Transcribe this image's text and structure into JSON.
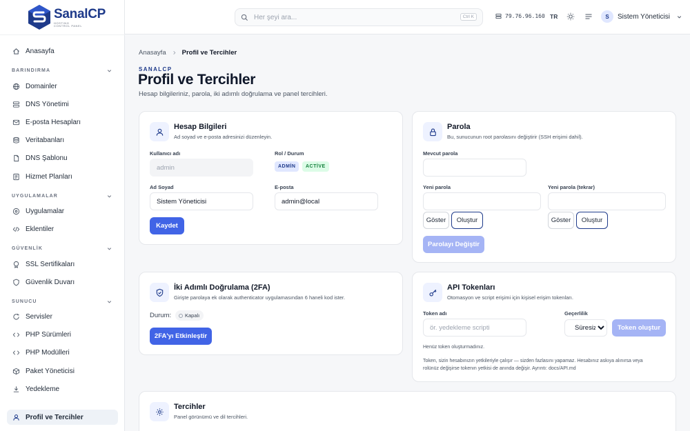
{
  "brand": {
    "name": "SanalCP",
    "tagline_1": "HOSTING",
    "tagline_2": "CONTROL PANEL"
  },
  "colors": {
    "primary": "#4164e6",
    "navy": "#1e3a8a",
    "success": "#15803d"
  },
  "sidebar": {
    "home": {
      "label": "Anasayfa",
      "icon": "home-icon"
    },
    "sections": [
      {
        "title": "BARINDIRMA",
        "items": [
          {
            "label": "Domainler",
            "icon": "globe-icon"
          },
          {
            "label": "DNS Yönetimi",
            "icon": "dns-icon"
          },
          {
            "label": "E-posta Hesapları",
            "icon": "mail-icon"
          },
          {
            "label": "Veritabanları",
            "icon": "database-icon"
          },
          {
            "label": "DNS Şablonu",
            "icon": "template-icon"
          },
          {
            "label": "Hizmet Planları",
            "icon": "plans-icon"
          }
        ]
      },
      {
        "title": "UYGULAMALAR",
        "items": [
          {
            "label": "Uygulamalar",
            "icon": "apps-icon"
          },
          {
            "label": "Eklentiler",
            "icon": "code-icon"
          }
        ]
      },
      {
        "title": "GÜVENLİK",
        "items": [
          {
            "label": "SSL Sertifikaları",
            "icon": "certificate-icon"
          },
          {
            "label": "Güvenlik Duvarı",
            "icon": "shield-icon"
          }
        ]
      },
      {
        "title": "SUNUCU",
        "items": [
          {
            "label": "Servisler",
            "icon": "refresh-icon"
          },
          {
            "label": "PHP Sürümleri",
            "icon": "php-icon"
          },
          {
            "label": "PHP Modülleri",
            "icon": "module-icon"
          },
          {
            "label": "Paket Yöneticisi",
            "icon": "package-icon"
          },
          {
            "label": "Yedekleme",
            "icon": "download-icon"
          }
        ]
      }
    ],
    "profile": {
      "label": "Profil ve Tercihler",
      "icon": "user-icon",
      "active": true
    }
  },
  "topbar": {
    "search_placeholder": "Her şeyi ara...",
    "shortcut": "Ctrl K",
    "ip": "79.76.96.160",
    "lang": "TR",
    "user_initial": "S",
    "user_name": "Sistem Yöneticisi"
  },
  "breadcrumb": {
    "home": "Anasayfa",
    "current": "Profil ve Tercihler"
  },
  "header": {
    "eyebrow": "SANALCP",
    "title": "Profil ve Tercihler",
    "subtitle": "Hesap bilgileriniz, parola, iki adımlı doğrulama ve panel tercihleri."
  },
  "account": {
    "title": "Hesap Bilgileri",
    "desc": "Ad soyad ve e-posta adresinizi düzenleyin.",
    "username_label": "Kullanıcı adı",
    "username_value": "admin",
    "role_label": "Rol / Durum",
    "role_badge": "ADMİN",
    "status_badge": "ACTİVE",
    "fullname_label": "Ad Soyad",
    "fullname_value": "Sistem Yöneticisi",
    "email_label": "E-posta",
    "email_value": "admin@local",
    "save_label": "Kaydet"
  },
  "password": {
    "title": "Parola",
    "desc": "Bu, sunucunun root parolasını değiştirir (SSH erişimi dahil).",
    "current_label": "Mevcut parola",
    "new_label": "Yeni parola",
    "repeat_label": "Yeni parola (tekrar)",
    "show_label": "Göster",
    "generate_label": "Oluştur",
    "submit_label": "Parolayı Değiştir"
  },
  "twofa": {
    "title": "İki Adımlı Doğrulama (2FA)",
    "desc": "Girişte parolaya ek olarak authenticator uygulamasından 6 haneli kod ister.",
    "status_label": "Durum:",
    "status_value": "Kapalı",
    "enable_label": "2FA'yı Etkinleştir"
  },
  "api": {
    "title": "API Tokenları",
    "desc": "Otomasyon ve script erişimi için kişisel erişim tokenları.",
    "name_label": "Token adı",
    "name_placeholder": "ör. yedekleme scripti",
    "validity_label": "Geçerlilik",
    "validity_value": "Süresiz",
    "create_label": "Token oluştur",
    "empty": "Henüz token oluşturmadınız.",
    "note_1": "Token, sizin hesabınızın yetkileriyle çalışır — sizden fazlasını yapamaz. Hesabınız askıya alınırsa veya",
    "note_2": "rolünüz değişirse tokenın yetkisi de anında değişir. Ayrıntı: docs/API.md"
  },
  "prefs": {
    "title": "Tercihler",
    "desc": "Panel görünümü ve dil tercihleri."
  }
}
